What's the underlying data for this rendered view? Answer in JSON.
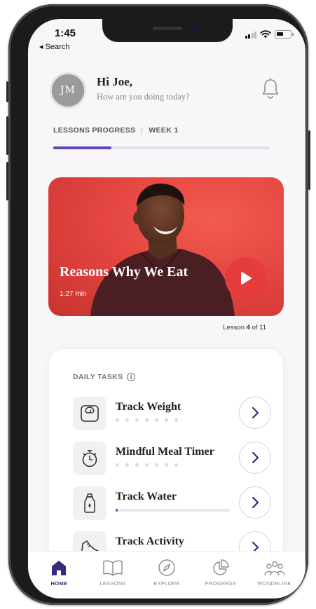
{
  "status_bar": {
    "time": "1:45",
    "back_label": "◂ Search"
  },
  "header": {
    "avatar_initials": "JM",
    "greeting": "Hi Joe,",
    "subtitle": "How are you doing today?"
  },
  "lessons_progress": {
    "label": "LESSONS PROGRESS",
    "week_label": "WEEK 1",
    "progress_fraction": 0.27
  },
  "featured_lesson": {
    "title": "Reasons Why We Eat",
    "duration": "1:27 min",
    "lesson_prefix": "Lesson",
    "lesson_number": "4",
    "lesson_suffix": "of 11"
  },
  "daily_tasks": {
    "header": "DAILY TASKS",
    "info_glyph": "i",
    "items": [
      {
        "name": "Track Weight",
        "icon": "scale-icon",
        "progress_type": "dots"
      },
      {
        "name": "Mindful Meal Timer",
        "icon": "stopwatch-icon",
        "progress_type": "dots"
      },
      {
        "name": "Track Water",
        "icon": "water-bottle-icon",
        "progress_type": "bar",
        "progress_fraction": 0.02
      },
      {
        "name": "Track Activity",
        "icon": "shoe-icon",
        "progress_type": "none"
      }
    ]
  },
  "bottom_nav": {
    "items": [
      {
        "label": "HOME",
        "icon": "home-icon",
        "active": true
      },
      {
        "label": "LESSONS",
        "icon": "book-icon",
        "active": false
      },
      {
        "label": "EXPLORE",
        "icon": "compass-icon",
        "active": false
      },
      {
        "label": "PROGRESS",
        "icon": "pie-chart-icon",
        "active": false
      },
      {
        "label": "WONDRLINK",
        "icon": "community-icon",
        "active": false
      }
    ]
  },
  "colors": {
    "accent_purple": "#6243b8",
    "nav_active": "#3b2a78",
    "lesson_card_red": "#e54641",
    "play_button": "#e53c3c"
  }
}
